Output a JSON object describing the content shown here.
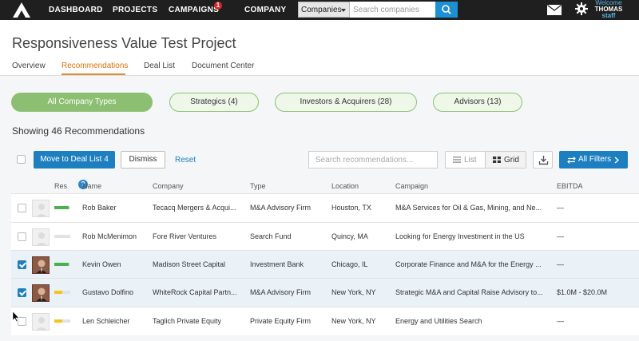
{
  "nav": {
    "items": [
      "DASHBOARD",
      "PROJECTS",
      "CAMPAIGNS",
      "COMPANY"
    ],
    "campaigns_badge": "1",
    "search_scope": "Companies",
    "search_placeholder": "Search companies",
    "welcome_line1": "Welcome",
    "welcome_name": "THOMAS",
    "welcome_role": "staff"
  },
  "project": {
    "title": "Responsiveness Value Test Project",
    "tabs": [
      "Overview",
      "Recommendations",
      "Deal List",
      "Document Center"
    ],
    "active_tab": "Recommendations"
  },
  "filters": {
    "pills": [
      "All Company Types",
      "Strategics (4)",
      "Investors & Acquirers (28)",
      "Advisors (13)"
    ],
    "active_pill": "All Company Types"
  },
  "summary": "Showing 46 Recommendations",
  "toolbar": {
    "move_label": "Move to Deal List 4",
    "dismiss_label": "Dismiss",
    "reset_label": "Reset",
    "search_placeholder": "Search recommendations...",
    "list_label": "List",
    "grid_label": "Grid",
    "filters_label": "All Filters"
  },
  "table": {
    "columns": [
      "Res",
      "Name",
      "Company",
      "Type",
      "Location",
      "Campaign",
      "EBITDA"
    ],
    "rows": [
      {
        "name": "Rob Baker",
        "company": "Tecacq Mergers & Acqui...",
        "type": "M&A Advisory Firm",
        "location": "Houston, TX",
        "campaign": "M&A Services for Oil & Gas, Mining, and Ne...",
        "ebitda": "—",
        "checked": false,
        "photo": false,
        "res_fraction": 0.9,
        "res_color": "#4caf50"
      },
      {
        "name": "Rob McMenimon",
        "company": "Fore River Ventures",
        "type": "Search Fund",
        "location": "Quincy, MA",
        "campaign": "Looking for Energy Investment in the US",
        "ebitda": "—",
        "checked": false,
        "photo": false,
        "res_fraction": 0,
        "res_color": "#e2e2e2"
      },
      {
        "name": "Kevin Owen",
        "company": "Madison Street Capital",
        "type": "Investment Bank",
        "location": "Chicago, IL",
        "campaign": "Corporate Finance and M&A for the Energy ...",
        "ebitda": "—",
        "checked": true,
        "photo": true,
        "res_fraction": 0.9,
        "res_color": "#4caf50"
      },
      {
        "name": "Gustavo Dolfino",
        "company": "WhiteRock Capital Partn...",
        "type": "M&A Advisory Firm",
        "location": "New York, NY",
        "campaign": "Strategic M&A and Capital Raise Advisory to...",
        "ebitda": "$1.0M - $20.0M",
        "checked": true,
        "photo": true,
        "res_fraction": 0.5,
        "res_color": "#f5c518"
      },
      {
        "name": "Len Schleicher",
        "company": "Taglich Private Equity",
        "type": "Private Equity Firm",
        "location": "New York, NY",
        "campaign": "Energy and Utilities Search",
        "ebitda": "—",
        "checked": false,
        "photo": false,
        "res_fraction": 0.5,
        "res_color": "#f5c518"
      }
    ]
  }
}
